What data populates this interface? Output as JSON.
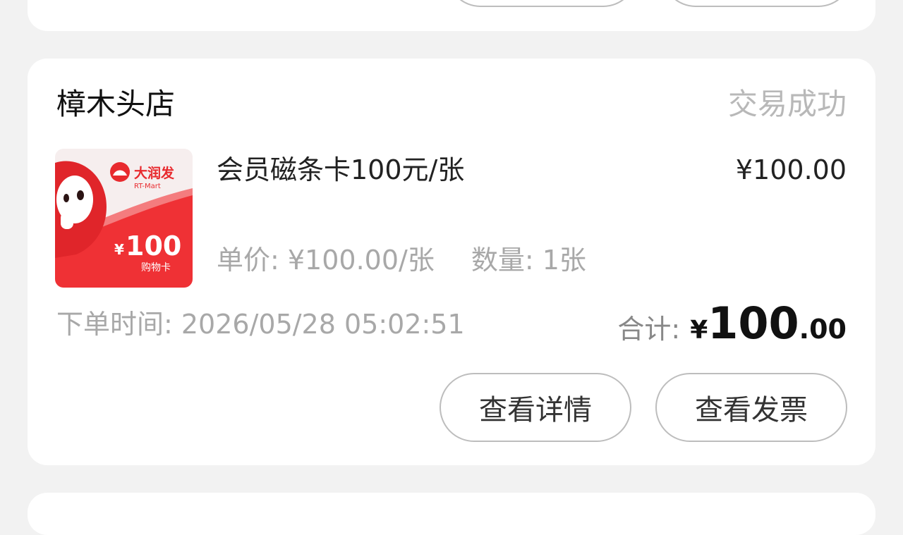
{
  "order": {
    "store_name": "樟木头店",
    "status": "交易成功",
    "product": {
      "name": "会员磁条卡100元/张",
      "price": "¥100.00",
      "unit_price": "单价: ¥100.00/张",
      "quantity": "数量: 1张",
      "image": {
        "brand": "大润发",
        "brand_en": "RT-Mart",
        "currency": "¥",
        "value": "100",
        "caption": "购物卡",
        "colors": {
          "primary": "#ee2e31",
          "light": "#f8f2f2"
        }
      }
    },
    "order_time": "下单时间: 2026/05/28 05:02:51",
    "total": {
      "label": "合计:",
      "currency": "¥",
      "integer": "100",
      "decimal": ".00"
    },
    "actions": {
      "details": "查看详情",
      "invoice": "查看发票"
    }
  }
}
